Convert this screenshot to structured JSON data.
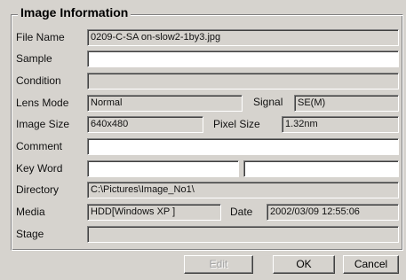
{
  "group_title": "Image Information",
  "fields": {
    "file_name": {
      "label": "File Name",
      "value": "0209-C-SA on-slow2-1by3.jpg"
    },
    "sample": {
      "label": "Sample",
      "value": ""
    },
    "condition": {
      "label": "Condition",
      "value": ""
    },
    "lens_mode": {
      "label": "Lens Mode",
      "value": "Normal"
    },
    "signal": {
      "label": "Signal",
      "value": "SE(M)"
    },
    "image_size": {
      "label": "Image Size",
      "value": "640x480"
    },
    "pixel_size": {
      "label": "Pixel Size",
      "value": "1.32nm"
    },
    "comment": {
      "label": "Comment",
      "value": ""
    },
    "key_word": {
      "label": "Key Word",
      "value_1": "",
      "value_2": ""
    },
    "directory": {
      "label": "Directory",
      "value": "C:\\Pictures\\Image_No1\\"
    },
    "media": {
      "label": "Media",
      "value": "HDD[Windows XP ]"
    },
    "date": {
      "label": "Date",
      "value": "2002/03/09 12:55:06"
    },
    "stage": {
      "label": "Stage",
      "value": ""
    }
  },
  "buttons": {
    "edit": "Edit",
    "ok": "OK",
    "cancel": "Cancel"
  },
  "colors": {
    "panel_bg": "#d6d3ce",
    "field_editable_bg": "#ffffff",
    "disabled_text": "#a0a0a0"
  }
}
